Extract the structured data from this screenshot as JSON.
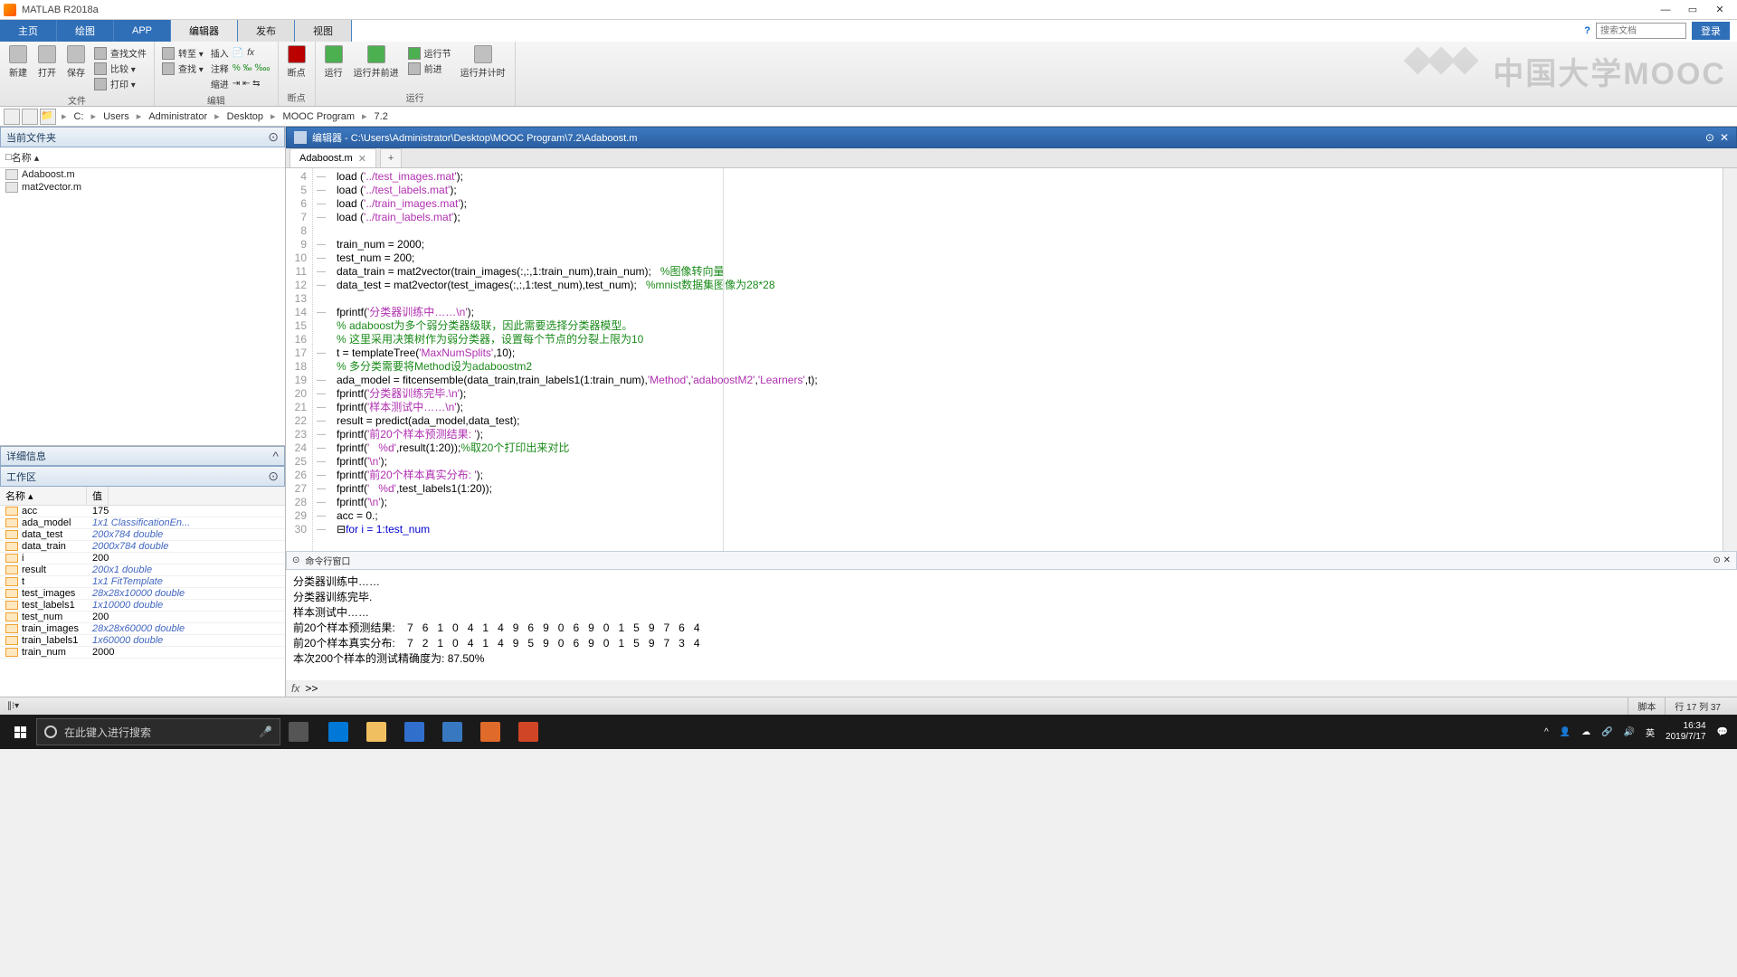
{
  "title": "MATLAB R2018a",
  "maintabs": {
    "home": "主页",
    "plot": "绘图",
    "app": "APP",
    "editor": "编辑器",
    "publish": "发布",
    "view": "视图"
  },
  "search_ph": "搜索文档",
  "login": "登录",
  "ribbon": {
    "g1": {
      "new": "新建",
      "open": "打开",
      "save": "保存",
      "find": "查找文件",
      "compare": "比较 ▾",
      "print": "打印 ▾",
      "label": "文件"
    },
    "g2": {
      "insert": "插入",
      "comment": "注释",
      "indent": "缩进",
      "goto": "转至 ▾",
      "find2": "查找 ▾",
      "fx": "fx",
      "label": "编辑"
    },
    "g3": {
      "bp": "断点",
      "label": "断点"
    },
    "g4": {
      "run": "运行",
      "runadv": "运行并前进",
      "advance": "前进",
      "runsec": "运行节",
      "runtime": "运行并计时",
      "label": "运行"
    },
    "watermark": "中国大学MOOC"
  },
  "path": {
    "c": "C:",
    "users": "Users",
    "admin": "Administrator",
    "desk": "Desktop",
    "mooc": "MOOC Program",
    "f72": "7.2"
  },
  "panels": {
    "curfolder": "当前文件夹",
    "name": "名称 ▴",
    "detail": "详细信息",
    "workspace": "工作区",
    "wsname": "名称 ▴",
    "wsval": "值"
  },
  "files": {
    "f1": "Adaboost.m",
    "f2": "mat2vector.m"
  },
  "ws": [
    {
      "n": "acc",
      "v": "175",
      "num": true
    },
    {
      "n": "ada_model",
      "v": "1x1 ClassificationEn..."
    },
    {
      "n": "data_test",
      "v": "200x784 double"
    },
    {
      "n": "data_train",
      "v": "2000x784 double"
    },
    {
      "n": "i",
      "v": "200",
      "num": true
    },
    {
      "n": "result",
      "v": "200x1 double"
    },
    {
      "n": "t",
      "v": "1x1 FitTemplate"
    },
    {
      "n": "test_images",
      "v": "28x28x10000 double"
    },
    {
      "n": "test_labels1",
      "v": "1x10000 double"
    },
    {
      "n": "test_num",
      "v": "200",
      "num": true
    },
    {
      "n": "train_images",
      "v": "28x28x60000 double"
    },
    {
      "n": "train_labels1",
      "v": "1x60000 double"
    },
    {
      "n": "train_num",
      "v": "2000",
      "num": true
    }
  ],
  "editor_path": "编辑器 - C:\\Users\\Administrator\\Desktop\\MOOC Program\\7.2\\Adaboost.m",
  "tabname": "Adaboost.m",
  "gutter_start": 4,
  "gutter_end": 30,
  "dash": "—",
  "code": {
    "l4a": "load (",
    "l4b": "'../test_images.mat'",
    "l4c": ");",
    "l5a": "load (",
    "l5b": "'../test_labels.mat'",
    "l5c": ");",
    "l6a": "load (",
    "l6b": "'../train_images.mat'",
    "l6c": ");",
    "l7a": "load (",
    "l7b": "'../train_labels.mat'",
    "l7c": ");",
    "l9": "train_num = 2000;",
    "l10": "test_num = 200;",
    "l11a": "data_train = mat2vector(train_images(:,:,1:train_num),train_num);   ",
    "l11b": "%图像转向量",
    "l12a": "data_test = mat2vector(test_images(:,:,1:test_num),test_num);   ",
    "l12b": "%mnist数据集图像为28*28",
    "l14a": "fprintf(",
    "l14b": "'分类器训练中……\\n'",
    "l14c": ");",
    "l15": "% adaboost为多个弱分类器级联，因此需要选择分类器模型。",
    "l16": "% 这里采用决策树作为弱分类器，设置每个节点的分裂上限为10",
    "l17a": "t = templateTree(",
    "l17b": "'MaxNumSplits'",
    "l17c": ",10);",
    "l18": "% 多分类需要将Method设为adaboostm2",
    "l19a": "ada_model = fitcensemble(data_train,train_labels1(1:train_num),",
    "l19b": "'Method'",
    "l19c": ",",
    "l19d": "'adaboostM2'",
    "l19e": ",",
    "l19f": "'Learners'",
    "l19g": ",t);",
    "l20a": "fprintf(",
    "l20b": "'分类器训练完毕.\\n'",
    "l20c": ");",
    "l21a": "fprintf(",
    "l21b": "'样本测试中……\\n'",
    "l21c": ");",
    "l22": "result = predict(ada_model,data_test);",
    "l23a": "fprintf(",
    "l23b": "'前20个样本预测结果: '",
    "l23c": ");",
    "l24a": "fprintf(",
    "l24b": "'   %d'",
    "l24c": ",result(1:20));",
    "l24d": "%取20个打印出来对比",
    "l25a": "fprintf(",
    "l25b": "'\\n'",
    "l25c": ");",
    "l26a": "fprintf(",
    "l26b": "'前20个样本真实分布: '",
    "l26c": ");",
    "l27a": "fprintf(",
    "l27b": "'   %d'",
    "l27c": ",test_labels1(1:20));",
    "l28a": "fprintf(",
    "l28b": "'\\n'",
    "l28c": ");",
    "l29": "acc = 0.;",
    "l30": "for i = 1:test_num"
  },
  "cmdhdr": "命令行窗口",
  "cmd": {
    "l1": "分类器训练中……",
    "l2": "分类器训练完毕.",
    "l3": "样本测试中……",
    "l4": "前20个样本预测结果:    7   6   1   0   4   1   4   9   6   9   0   6   9   0   1   5   9   7   6   4",
    "l5": "前20个样本真实分布:    7   2   1   0   4   1   4   9   5   9   0   6   9   0   1   5   9   7   3   4",
    "l6": "本次200个样本的测试精确度为: 87.50%",
    "prompt": ">>"
  },
  "status": {
    "script": "脚本",
    "loc": "行 17   列 37"
  },
  "taskbar": {
    "search": "在此键入进行搜索",
    "ime": "英",
    "time": "16:34",
    "date": "2019/7/17"
  }
}
